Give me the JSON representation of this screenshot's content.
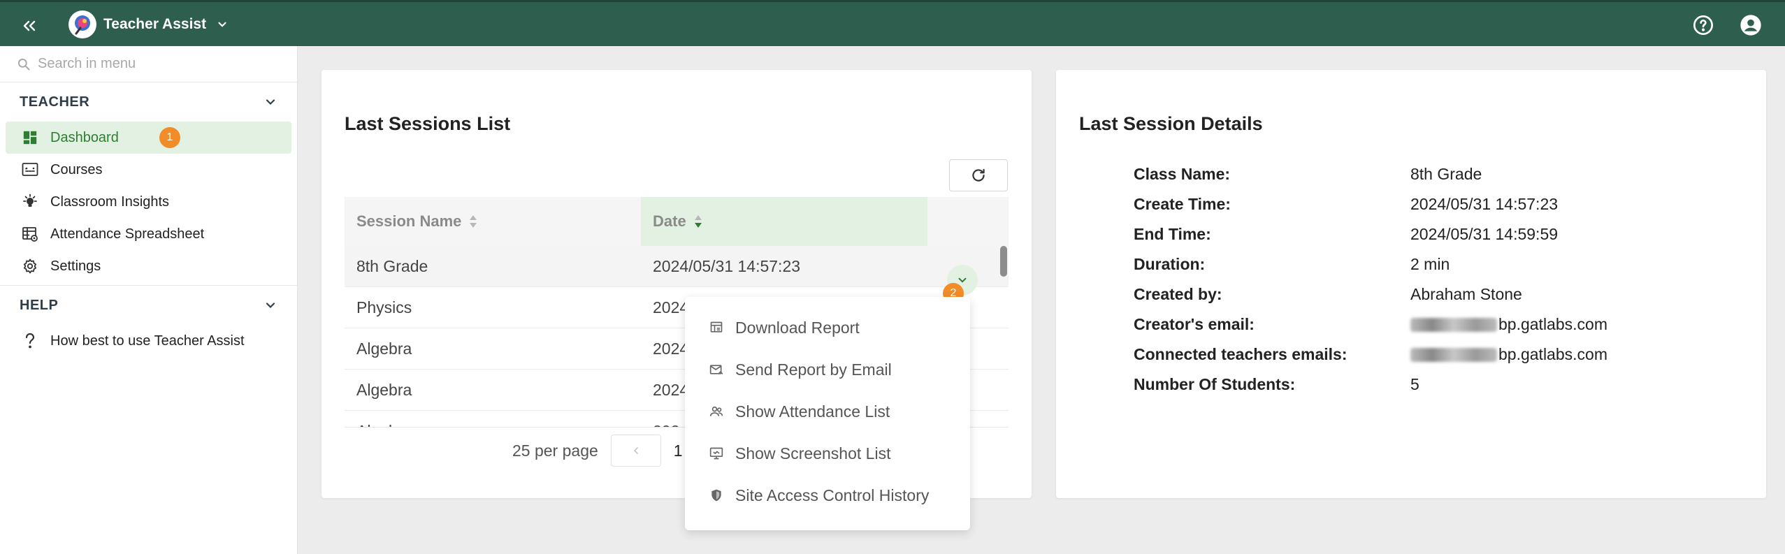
{
  "header": {
    "app_name": "Teacher Assist",
    "icons": [
      "double-chevron-left-icon",
      "chevron-down-icon",
      "help-icon",
      "account-icon"
    ]
  },
  "sidebar": {
    "search_placeholder": "Search in menu",
    "sections": [
      {
        "title": "TEACHER",
        "items": [
          {
            "label": "Dashboard",
            "icon": "dashboard-icon",
            "active": true,
            "badge": "1"
          },
          {
            "label": "Courses",
            "icon": "courses-icon"
          },
          {
            "label": "Classroom Insights",
            "icon": "lightbulb-icon"
          },
          {
            "label": "Attendance Spreadsheet",
            "icon": "spreadsheet-icon"
          },
          {
            "label": "Settings",
            "icon": "gear-icon"
          }
        ]
      },
      {
        "title": "HELP",
        "items": [
          {
            "label": "How best to use Teacher Assist",
            "icon": "question-icon"
          }
        ]
      }
    ]
  },
  "sessions": {
    "title": "Last Sessions List",
    "columns": [
      "Session Name",
      "Date"
    ],
    "rows": [
      {
        "name": "8th Grade",
        "date": "2024/05/31 14:57:23"
      },
      {
        "name": "Physics",
        "date": "2024"
      },
      {
        "name": "Algebra",
        "date": "2024"
      },
      {
        "name": "Algebra",
        "date": "2024"
      },
      {
        "name": "Algeb",
        "date": "202"
      }
    ],
    "row_badge": "2",
    "pagination": {
      "per_page": "25 per page",
      "current_page": "1"
    }
  },
  "row_menu": {
    "items": [
      {
        "label": "Download Report",
        "icon": "download-report-icon"
      },
      {
        "label": "Send Report by Email",
        "icon": "email-icon"
      },
      {
        "label": "Show Attendance List",
        "icon": "people-icon"
      },
      {
        "label": "Show Screenshot List",
        "icon": "monitor-icon"
      },
      {
        "label": "Site Access Control History",
        "icon": "shield-icon"
      }
    ]
  },
  "details": {
    "title": "Last Session Details",
    "fields": [
      {
        "label": "Class Name:",
        "value": "8th Grade"
      },
      {
        "label": "Create Time:",
        "value": "2024/05/31 14:57:23"
      },
      {
        "label": "End Time:",
        "value": "2024/05/31 14:59:59"
      },
      {
        "label": "Duration:",
        "value": "2 min"
      },
      {
        "label": "Created by:",
        "value": "Abraham Stone"
      },
      {
        "label": "Creator's email:",
        "value": "bp.gatlabs.com",
        "redacted": true
      },
      {
        "label": "Connected teachers emails:",
        "value": "bp.gatlabs.com",
        "redacted": true
      },
      {
        "label": "Number Of Students:",
        "value": "5"
      }
    ]
  },
  "colors": {
    "header_bg": "#2e5e4e",
    "accent_green": "#2e7d32",
    "active_bg": "#e3f1e3",
    "badge_orange": "#f28c28"
  }
}
